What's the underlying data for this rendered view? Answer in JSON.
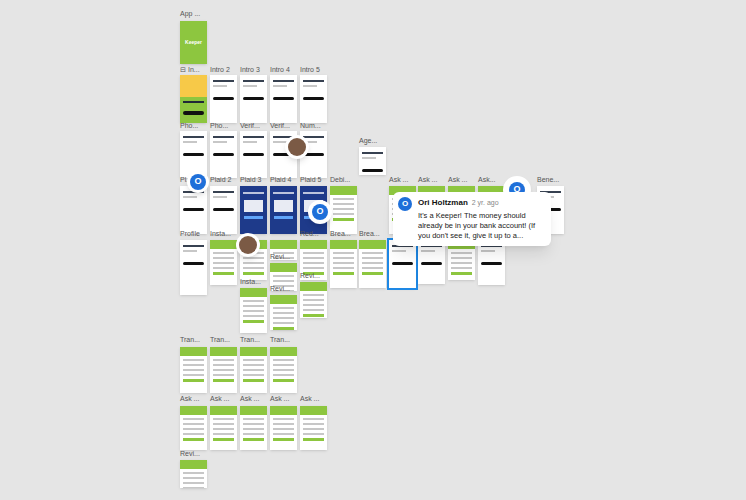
{
  "canvas": {
    "frames": [
      {
        "label": "App ...",
        "kind": "brand",
        "text": "Keeper",
        "selected": false
      },
      {
        "label": "⊟ In...",
        "kind": "promo",
        "selected": false
      },
      {
        "label": "Intro 2",
        "kind": "plain",
        "selected": false
      },
      {
        "label": "Intro 3",
        "kind": "plain",
        "selected": false
      },
      {
        "label": "Intro 4",
        "kind": "plain",
        "selected": false
      },
      {
        "label": "Intro 5",
        "kind": "plain",
        "selected": false
      },
      {
        "label": "Pho...",
        "kind": "plain",
        "selected": false
      },
      {
        "label": "Pho...",
        "kind": "plain",
        "selected": false
      },
      {
        "label": "Verif...",
        "kind": "plain",
        "selected": false
      },
      {
        "label": "Verif...",
        "kind": "plain",
        "selected": false
      },
      {
        "label": "Num...",
        "kind": "plain",
        "selected": false
      },
      {
        "label": "Age...",
        "kind": "plain",
        "selected": false
      },
      {
        "label": "Pl...",
        "kind": "plain",
        "selected": false
      },
      {
        "label": "Plaid 2",
        "kind": "plain",
        "selected": false
      },
      {
        "label": "Plaid 3",
        "kind": "dark",
        "selected": false
      },
      {
        "label": "Plaid 4",
        "kind": "dark",
        "selected": false
      },
      {
        "label": "Plaid 5",
        "kind": "dark",
        "selected": false
      },
      {
        "label": "Debi...",
        "kind": "header",
        "selected": false
      },
      {
        "label": "Ask ...",
        "kind": "header",
        "selected": false
      },
      {
        "label": "Ask ...",
        "kind": "header",
        "selected": false
      },
      {
        "label": "Ask ...",
        "kind": "header",
        "selected": false
      },
      {
        "label": "Ask...",
        "kind": "header",
        "selected": false
      },
      {
        "label": "Bene...",
        "kind": "plain",
        "selected": false
      },
      {
        "label": "Profile",
        "kind": "plain",
        "selected": false
      },
      {
        "label": "Insta...",
        "kind": "header",
        "selected": false
      },
      {
        "label": "Red...",
        "kind": "header",
        "selected": false
      },
      {
        "label": "Brea...",
        "kind": "header",
        "selected": false
      },
      {
        "label": "Brea...",
        "kind": "header",
        "selected": false
      },
      {
        "kind": "plain",
        "selected": true
      },
      {
        "kind": "plain",
        "selected": false
      },
      {
        "kind": "header",
        "selected": false
      },
      {
        "kind": "plain",
        "selected": false
      },
      {
        "kind": "header",
        "selected": false
      },
      {
        "kind": "header",
        "selected": false
      },
      {
        "label": "Revi...",
        "kind": "header",
        "selected": false
      },
      {
        "label": "Insta...",
        "kind": "header",
        "selected": false
      },
      {
        "label": "Revi...",
        "kind": "header",
        "selected": false
      },
      {
        "label": "Revi...",
        "kind": "header",
        "selected": false
      },
      {
        "label": "Tran...",
        "kind": "header",
        "selected": false
      },
      {
        "label": "Tran...",
        "kind": "header",
        "selected": false
      },
      {
        "label": "Tran...",
        "kind": "header",
        "selected": false
      },
      {
        "label": "Tran...",
        "kind": "header",
        "selected": false
      },
      {
        "label": "Ask ...",
        "kind": "header",
        "selected": false
      },
      {
        "label": "Ask ...",
        "kind": "header",
        "selected": false
      },
      {
        "label": "Ask ...",
        "kind": "header",
        "selected": false
      },
      {
        "label": "Ask ...",
        "kind": "header",
        "selected": false
      },
      {
        "label": "Ask ...",
        "kind": "header",
        "selected": false
      },
      {
        "label": "Revi...",
        "kind": "header",
        "selected": false
      }
    ],
    "pins": [
      {
        "kind": "photo"
      },
      {
        "kind": "letter",
        "initial": "O"
      },
      {
        "kind": "letter",
        "initial": "O"
      },
      {
        "kind": "photo"
      },
      {
        "kind": "letter",
        "initial": "O"
      }
    ],
    "comment": {
      "initial": "O",
      "author": "Ori Holtzman",
      "time": "2 yr. ago",
      "text": "It's a Keeper! The money should already be in your bank account! (If you don't see it, give it up to a..."
    }
  }
}
